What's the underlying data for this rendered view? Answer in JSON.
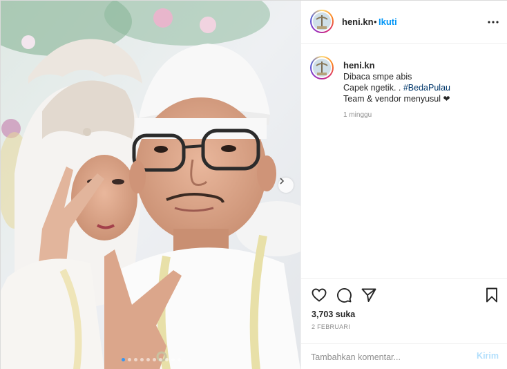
{
  "header": {
    "username": "heni.kn",
    "separator": "•",
    "follow_label": "Ikuti",
    "more_icon": "more-horizontal-icon"
  },
  "caption": {
    "username": "heni.kn",
    "lines": [
      "Dibaca smpe abis",
      "Capek ngetik. . ",
      "Team & vendor menyusul "
    ],
    "hashtag": "#BedaPulau",
    "heart": "❤",
    "time_ago": "1 minggu"
  },
  "actions": {
    "like_icon": "heart-outline-icon",
    "comment_icon": "comment-icon",
    "share_icon": "paper-plane-icon",
    "save_icon": "bookmark-icon",
    "likes_text": "3,703 suka",
    "date_text": "2 FEBRUARI"
  },
  "comment": {
    "placeholder": "Tambahkan komentar...",
    "post_label": "Kirim"
  },
  "media": {
    "slide_count": 10,
    "active_index": 0,
    "next_icon": "chevron-right-icon"
  },
  "colors": {
    "link_blue": "#0095f6",
    "hashtag_blue": "#00376b",
    "post_disabled": "#b2dffc",
    "muted": "#8e8e8e"
  }
}
